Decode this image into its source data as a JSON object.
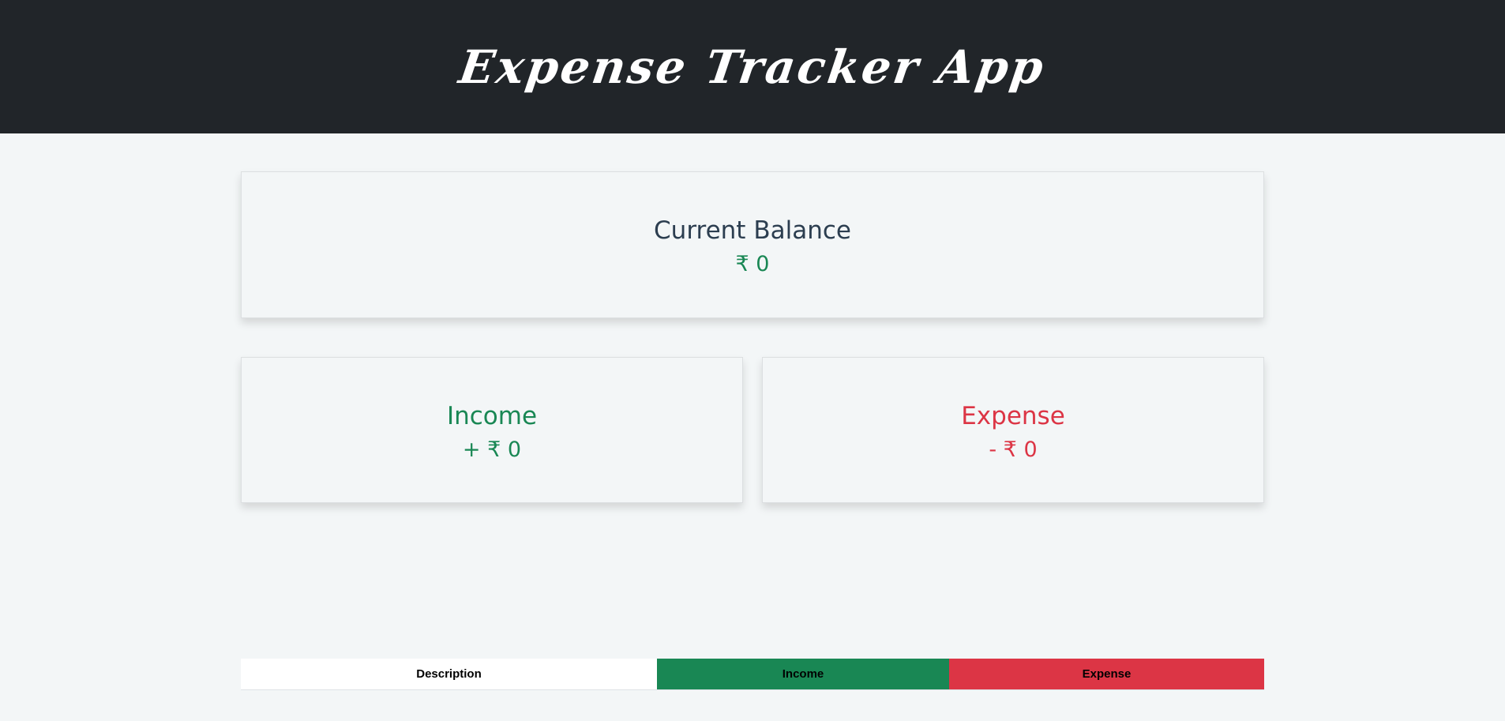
{
  "header": {
    "title": "Expense Tracker App"
  },
  "balance": {
    "label": "Current Balance",
    "amount": "₹ 0"
  },
  "income": {
    "label": "Income",
    "amount": "+ ₹ 0"
  },
  "expense": {
    "label": "Expense",
    "amount": "- ₹ 0"
  },
  "table": {
    "headers": [
      "Description",
      "Income",
      "Expense"
    ]
  },
  "colors": {
    "header_bg": "#212529",
    "page_bg": "#f3f6f7",
    "income": "#198754",
    "expense": "#dc3545",
    "balance_label": "#2c3e50"
  }
}
